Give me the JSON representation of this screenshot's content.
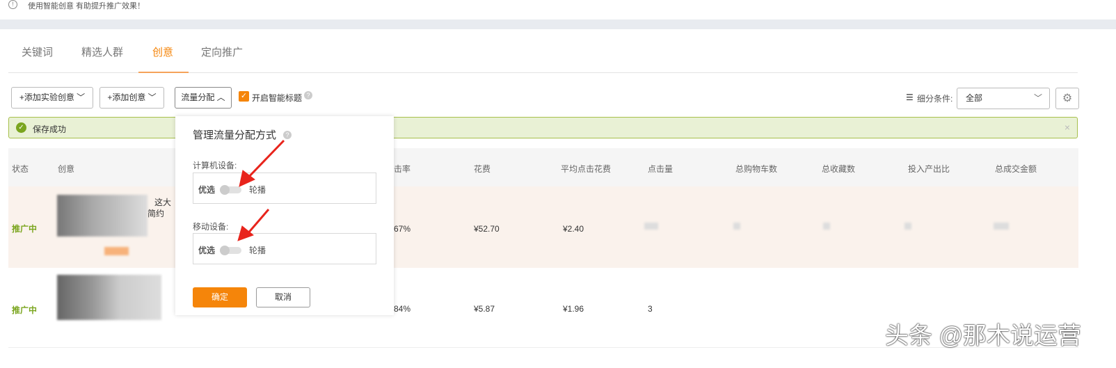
{
  "tip": {
    "icon": "info-circle-icon",
    "text": "使用智能创意 有助提升推广效果！"
  },
  "tabs": [
    {
      "label": "关键词"
    },
    {
      "label": "精选人群"
    },
    {
      "label": "创意",
      "active": true
    },
    {
      "label": "定向推广"
    }
  ],
  "toolbar": {
    "add_experiment": "+添加实验创意",
    "add_creative": "+添加创意",
    "traffic": "流量分配",
    "smart_title": "开启智能标题",
    "smart_title_checked": true,
    "filter_label": "细分条件:",
    "filter_value": "全部"
  },
  "alert": {
    "text": "保存成功"
  },
  "table": {
    "headers": [
      "状态",
      "创意",
      "击率",
      "花费",
      "平均点击花费",
      "点击量",
      "总购物车数",
      "总收藏数",
      "投入产出比",
      "总成交金额"
    ],
    "rows": [
      {
        "status": "推广中",
        "creative_text": [
          "这大",
          "简约"
        ],
        "ctr": "67%",
        "cost": "¥52.70",
        "avg_cpc": "¥2.40",
        "clicks": ""
      },
      {
        "status": "推广中",
        "creative_text": [],
        "ctr": "84%",
        "cost": "¥5.87",
        "avg_cpc": "¥1.96",
        "clicks": "3"
      }
    ]
  },
  "popup": {
    "title": "管理流量分配方式",
    "pc_label": "计算机设备:",
    "mobile_label": "移动设备:",
    "opt_left": "优选",
    "opt_right": "轮播",
    "confirm": "确定",
    "cancel": "取消"
  },
  "watermark": "头条 @那木说运营",
  "colors": {
    "accent": "#f5850a",
    "success": "#7aa51e",
    "alert_bg": "#e9f1d5",
    "arrow": "#e8241c"
  }
}
